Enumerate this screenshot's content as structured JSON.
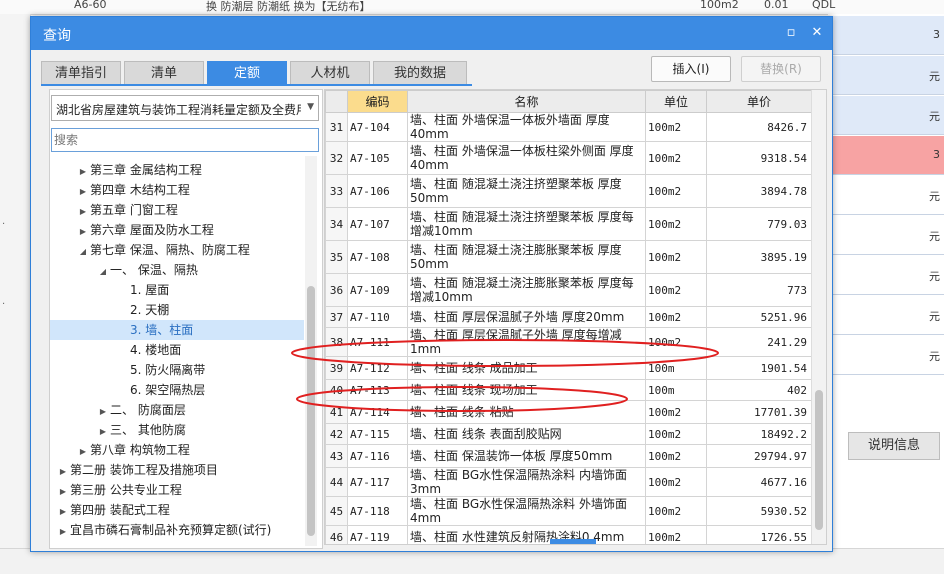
{
  "bg": {
    "top_code": "A6-60",
    "top_text": "换   防潮层 防潮纸 换为【无纺布】",
    "top_unit": "100m2",
    "top_price": "0.01",
    "top_right": "QDL",
    "right_cells": [
      "3",
      "元",
      "元",
      "3",
      "元",
      "元",
      "元",
      "元",
      "元"
    ],
    "right_tab": "说明信息"
  },
  "dialog": {
    "title": "查询",
    "restore_icon": "▫",
    "close_icon": "✕",
    "tabs": [
      "清单指引",
      "清单",
      "定额",
      "人材机",
      "我的数据"
    ],
    "active_tab": "定额",
    "insert_label": "插入(I)",
    "replace_label": "替换(R)"
  },
  "left": {
    "library": "湖北省房屋建筑与装饰工程消耗量定额及全费用",
    "search_placeholder": "搜索",
    "tree": [
      {
        "label": "第三章 金属结构工程",
        "level": 2,
        "twisty": "▶"
      },
      {
        "label": "第四章 木结构工程",
        "level": 2,
        "twisty": "▶"
      },
      {
        "label": "第五章 门窗工程",
        "level": 2,
        "twisty": "▶"
      },
      {
        "label": "第六章 屋面及防水工程",
        "level": 2,
        "twisty": "▶"
      },
      {
        "label": "第七章 保温、隔热、防腐工程",
        "level": 2,
        "twisty": "◢"
      },
      {
        "label": "一、 保温、隔热",
        "level": 3,
        "twisty": "◢"
      },
      {
        "label": "1. 屋面",
        "level": 4,
        "twisty": ""
      },
      {
        "label": "2. 天棚",
        "level": 4,
        "twisty": ""
      },
      {
        "label": "3. 墙、柱面",
        "level": 4,
        "twisty": "",
        "selected": true
      },
      {
        "label": "4. 楼地面",
        "level": 4,
        "twisty": ""
      },
      {
        "label": "5. 防火隔离带",
        "level": 4,
        "twisty": ""
      },
      {
        "label": "6. 架空隔热层",
        "level": 4,
        "twisty": ""
      },
      {
        "label": "二、 防腐面层",
        "level": 3,
        "twisty": "▶"
      },
      {
        "label": "三、 其他防腐",
        "level": 3,
        "twisty": "▶"
      },
      {
        "label": "第八章 构筑物工程",
        "level": 2,
        "twisty": "▶"
      },
      {
        "label": "第二册 装饰工程及措施项目",
        "level": 1,
        "twisty": "▶"
      },
      {
        "label": "第三册 公共专业工程",
        "level": 1,
        "twisty": "▶"
      },
      {
        "label": "第四册 装配式工程",
        "level": 1,
        "twisty": "▶"
      },
      {
        "label": "宜昌市磷石膏制品补充预算定额(试行)",
        "level": 1,
        "twisty": "▶"
      }
    ]
  },
  "grid": {
    "columns": [
      "",
      "编码",
      "名称",
      "单位",
      "单价"
    ],
    "rows": [
      {
        "idx": "31",
        "code": "A7-104",
        "name": "墙、柱面 外墙保温一体板外墙面 厚度40mm",
        "unit": "100m2",
        "price": "8426.7"
      },
      {
        "idx": "32",
        "code": "A7-105",
        "name": "墙、柱面 外墙保温一体板柱梁外侧面 厚度40mm",
        "unit": "100m2",
        "price": "9318.54"
      },
      {
        "idx": "33",
        "code": "A7-106",
        "name": "墙、柱面 随混凝土浇注挤塑聚苯板 厚度50mm",
        "unit": "100m2",
        "price": "3894.78"
      },
      {
        "idx": "34",
        "code": "A7-107",
        "name": "墙、柱面 随混凝土浇注挤塑聚苯板 厚度每增减10mm",
        "unit": "100m2",
        "price": "779.03"
      },
      {
        "idx": "35",
        "code": "A7-108",
        "name": "墙、柱面 随混凝土浇注膨胀聚苯板 厚度50mm",
        "unit": "100m2",
        "price": "3895.19"
      },
      {
        "idx": "36",
        "code": "A7-109",
        "name": "墙、柱面 随混凝土浇注膨胀聚苯板 厚度每增减10mm",
        "unit": "100m2",
        "price": "773"
      },
      {
        "idx": "37",
        "code": "A7-110",
        "name": "墙、柱面 厚层保温腻子外墙 厚度20mm",
        "unit": "100m2",
        "price": "5251.96"
      },
      {
        "idx": "38",
        "code": "A7-111",
        "name": "墙、柱面 厚层保温腻子外墙 厚度每增减1mm",
        "unit": "100m2",
        "price": "241.29"
      },
      {
        "idx": "39",
        "code": "A7-112",
        "name": "墙、柱面 线条 成品加工",
        "unit": "100m",
        "price": "1901.54"
      },
      {
        "idx": "40",
        "code": "A7-113",
        "name": "墙、柱面 线条 现场加工",
        "unit": "100m",
        "price": "402"
      },
      {
        "idx": "41",
        "code": "A7-114",
        "name": "墙、柱面 线条 粘贴",
        "unit": "100m2",
        "price": "17701.39"
      },
      {
        "idx": "42",
        "code": "A7-115",
        "name": "墙、柱面 线条 表面刮胶贴网",
        "unit": "100m2",
        "price": "18492.2"
      },
      {
        "idx": "43",
        "code": "A7-116",
        "name": "墙、柱面 保温装饰一体板 厚度50mm",
        "unit": "100m2",
        "price": "29794.97"
      },
      {
        "idx": "44",
        "code": "A7-117",
        "name": "墙、柱面 BG水性保温隔热涂料 内墙饰面3mm",
        "unit": "100m2",
        "price": "4677.16"
      },
      {
        "idx": "45",
        "code": "A7-118",
        "name": "墙、柱面 BG水性保温隔热涂料 外墙饰面4mm",
        "unit": "100m2",
        "price": "5930.52"
      },
      {
        "idx": "46",
        "code": "A7-119",
        "name": "墙、柱面 水性建筑反射隔热涂料0.4mm",
        "unit": "100m2",
        "price": "1726.55"
      }
    ],
    "row_heights": [
      21,
      33,
      33,
      33,
      33,
      33,
      21,
      21,
      23,
      21,
      23,
      21,
      23,
      23,
      23,
      23
    ]
  },
  "annotations": {
    "color": "#e02020",
    "highlighted_rows": [
      "39",
      "41"
    ]
  }
}
